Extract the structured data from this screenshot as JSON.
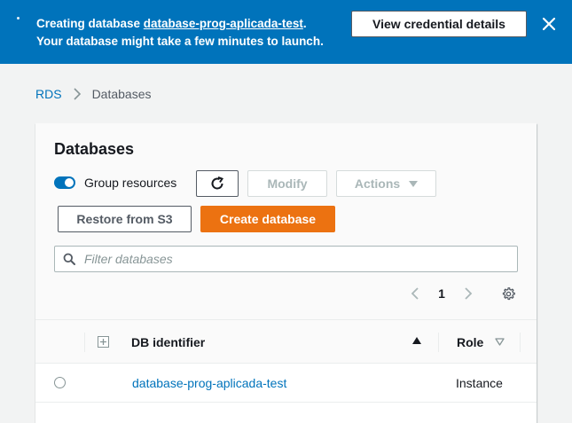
{
  "banner": {
    "message_prefix": "Creating database ",
    "database_link": "database-prog-aplicada-test",
    "message_suffix": ".",
    "message_line2": "Your database might take a few minutes to launch.",
    "view_credentials_label": "View credential details",
    "color": "#0073bb"
  },
  "breadcrumb": {
    "root": "RDS",
    "current": "Databases"
  },
  "panel": {
    "title": "Databases",
    "group_resources_label": "Group resources",
    "group_resources_enabled": true,
    "modify_label": "Modify",
    "actions_label": "Actions",
    "restore_label": "Restore from S3",
    "create_label": "Create database",
    "create_color": "#ec7211",
    "filter_placeholder": "Filter databases",
    "current_page": "1"
  },
  "table": {
    "columns": {
      "db_identifier": "DB identifier",
      "role": "Role"
    },
    "rows": [
      {
        "db_identifier": "database-prog-aplicada-test",
        "role": "Instance"
      }
    ]
  }
}
